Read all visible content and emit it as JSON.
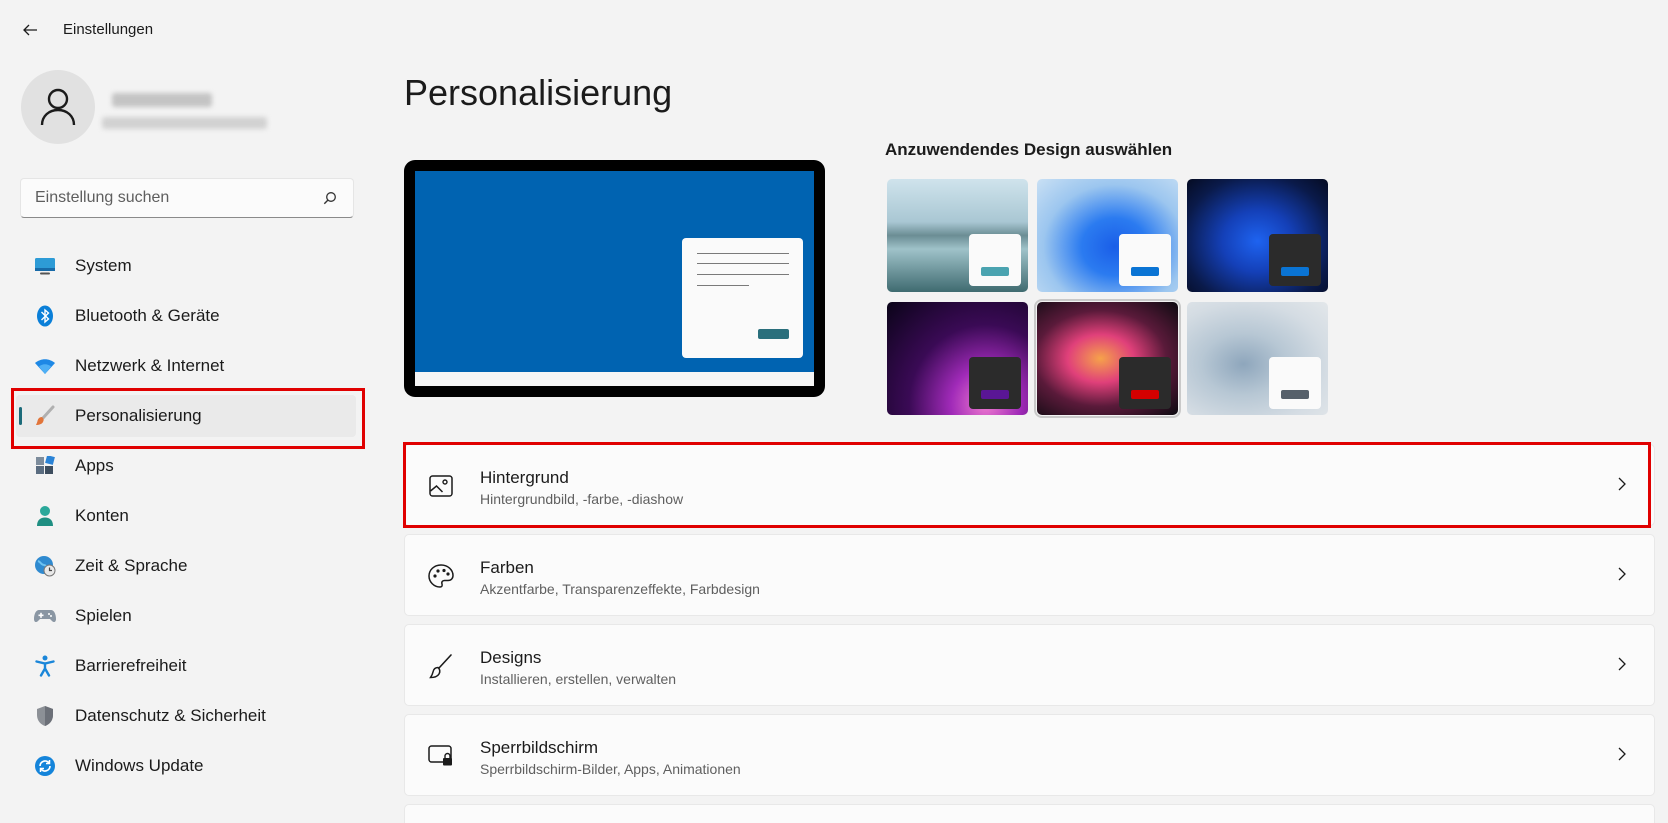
{
  "app": {
    "title": "Einstellungen"
  },
  "search": {
    "placeholder": "Einstellung suchen"
  },
  "sidebar": {
    "items": [
      {
        "label": "System",
        "icon": "system-icon"
      },
      {
        "label": "Bluetooth & Geräte",
        "icon": "bluetooth-icon"
      },
      {
        "label": "Netzwerk & Internet",
        "icon": "wifi-icon"
      },
      {
        "label": "Personalisierung",
        "icon": "paintbrush-icon",
        "active": true
      },
      {
        "label": "Apps",
        "icon": "apps-icon"
      },
      {
        "label": "Konten",
        "icon": "account-icon"
      },
      {
        "label": "Zeit & Sprache",
        "icon": "globe-clock-icon"
      },
      {
        "label": "Spielen",
        "icon": "gamepad-icon"
      },
      {
        "label": "Barrierefreiheit",
        "icon": "accessibility-icon"
      },
      {
        "label": "Datenschutz & Sicherheit",
        "icon": "shield-icon"
      },
      {
        "label": "Windows Update",
        "icon": "update-icon"
      }
    ]
  },
  "main": {
    "title": "Personalisierung",
    "themes_heading": "Anzuwendendes Design auswählen",
    "themes": [
      {
        "name": "lake",
        "accent": "#4aa3b0",
        "card": "light"
      },
      {
        "name": "bloom-light",
        "accent": "#0a74d4",
        "card": "light"
      },
      {
        "name": "bloom-dark",
        "accent": "#0a74d4",
        "card": "dark"
      },
      {
        "name": "glow",
        "accent": "#5a1696",
        "card": "dark"
      },
      {
        "name": "captured-motion",
        "accent": "#d40000",
        "card": "dark",
        "selected": true
      },
      {
        "name": "flow",
        "accent": "#56606a",
        "card": "light"
      }
    ],
    "settings": [
      {
        "title": "Hintergrund",
        "subtitle": "Hintergrundbild, -farbe, -diashow",
        "icon": "image-icon"
      },
      {
        "title": "Farben",
        "subtitle": "Akzentfarbe, Transparenzeffekte, Farbdesign",
        "icon": "palette-icon"
      },
      {
        "title": "Designs",
        "subtitle": "Installieren, erstellen, verwalten",
        "icon": "brush-icon"
      },
      {
        "title": "Sperrbildschirm",
        "subtitle": "Sperrbildschirm-Bilder, Apps, Animationen",
        "icon": "lockscreen-icon"
      }
    ]
  },
  "colors": {
    "accent": "#1c6b7a",
    "highlight": "#e00000",
    "preview_desktop": "#0063b1"
  }
}
